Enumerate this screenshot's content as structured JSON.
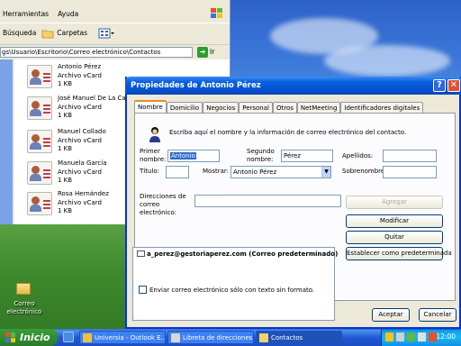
{
  "explorer": {
    "menu": [
      "Herramientas",
      "Ayuda"
    ],
    "toolbar": {
      "search": "Búsqueda",
      "folders": "Carpetas"
    },
    "address": "gs\\Usuario\\Escritorio\\Correo electrónico\\Contactos",
    "go_label": "Ir",
    "files": [
      {
        "name": "Antonio Pérez",
        "type": "Archivo vCard",
        "size": "1 KB"
      },
      {
        "name": "José Manuel De La Casa",
        "type": "Archivo vCard",
        "size": "1 KB"
      },
      {
        "name": "Manuel Collado",
        "type": "Archivo vCard",
        "size": "1 KB"
      },
      {
        "name": "Manuela García",
        "type": "Archivo vCard",
        "size": "1 KB"
      },
      {
        "name": "Rosa Hernández",
        "type": "Archivo vCard",
        "size": "1 KB"
      }
    ]
  },
  "desktop": {
    "folder_label": "Correo electrónico"
  },
  "dialog": {
    "title": "Propiedades de Antonio Pérez",
    "help": "?",
    "close": "✕",
    "tabs": [
      "Nombre",
      "Domicilio",
      "Negocios",
      "Personal",
      "Otros",
      "NetMeeting",
      "Identificadores digitales"
    ],
    "intro": "Escriba aquí el nombre y la información de correo electrónico del contacto.",
    "fields": {
      "first_name_label": "Primer nombre:",
      "first_name_value": "Antonio",
      "second_name_label": "Segundo nombre:",
      "second_name_value": "Pérez",
      "surname_label": "Apellidos:",
      "surname_value": "",
      "title_label": "Título:",
      "title_value": "",
      "display_label": "Mostrar:",
      "display_value": "Antonio Pérez",
      "nickname_label": "Sobrenombre:",
      "nickname_value": ""
    },
    "email_label": "Direcciones de correo electrónico:",
    "email_input": "",
    "add_button": "Agregar",
    "emails": [
      "a_perez@gestoriaperez.com  (Correo predeterminado)"
    ],
    "edit_button": "Modificar",
    "remove_button": "Quitar",
    "default_button": "Establecer como predeterminada",
    "plain_text_label": "Enviar correo electrónico sólo con texto sin formato.",
    "ok_button": "Aceptar",
    "cancel_button": "Cancelar"
  },
  "taskbar": {
    "start": "Inicio",
    "tasks": [
      "Universia - Outlook E...",
      "Libreta de direcciones ...",
      "Contactos"
    ],
    "clock": "12:00"
  }
}
